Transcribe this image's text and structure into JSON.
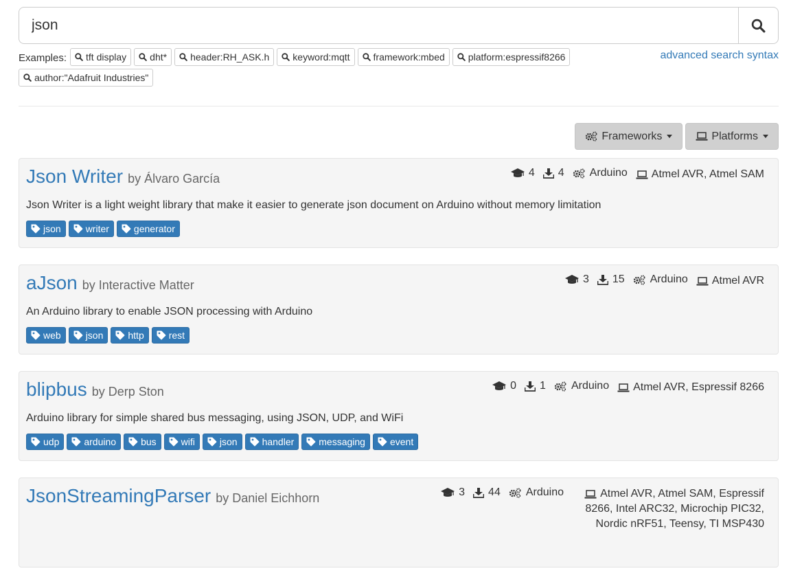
{
  "search": {
    "value": "json"
  },
  "examples": {
    "label": "Examples:",
    "items": [
      "tft display",
      "dht*",
      "header:RH_ASK.h",
      "keyword:mqtt",
      "framework:mbed",
      "platform:espressif8266",
      "author:\"Adafruit Industries\""
    ],
    "advanced_link": "advanced search syntax"
  },
  "filters": {
    "frameworks": "Frameworks",
    "platforms": "Platforms"
  },
  "results": [
    {
      "name": "Json Writer",
      "author": "by Álvaro García",
      "examples": "4",
      "downloads": "4",
      "framework": "Arduino",
      "platforms": "Atmel AVR, Atmel SAM",
      "description": "Json Writer is a light weight library that make it easier to generate json document on Arduino without memory limitation",
      "tags": [
        "json",
        "writer",
        "generator"
      ]
    },
    {
      "name": "aJson",
      "author": "by Interactive Matter",
      "examples": "3",
      "downloads": "15",
      "framework": "Arduino",
      "platforms": "Atmel AVR",
      "description": "An Arduino library to enable JSON processing with Arduino",
      "tags": [
        "web",
        "json",
        "http",
        "rest"
      ]
    },
    {
      "name": "blipbus",
      "author": "by Derp Ston",
      "examples": "0",
      "downloads": "1",
      "framework": "Arduino",
      "platforms": "Atmel AVR, Espressif 8266",
      "description": "Arduino library for simple shared bus messaging, using JSON, UDP, and WiFi",
      "tags": [
        "udp",
        "arduino",
        "bus",
        "wifi",
        "json",
        "handler",
        "messaging",
        "event"
      ]
    },
    {
      "name": "JsonStreamingParser",
      "author": "by Daniel Eichhorn",
      "examples": "3",
      "downloads": "44",
      "framework": "Arduino",
      "platforms": "Atmel AVR, Atmel SAM, Espressif 8266, Intel ARC32, Microchip PIC32, Nordic nRF51, Teensy, TI MSP430",
      "description": "",
      "tags": []
    }
  ]
}
